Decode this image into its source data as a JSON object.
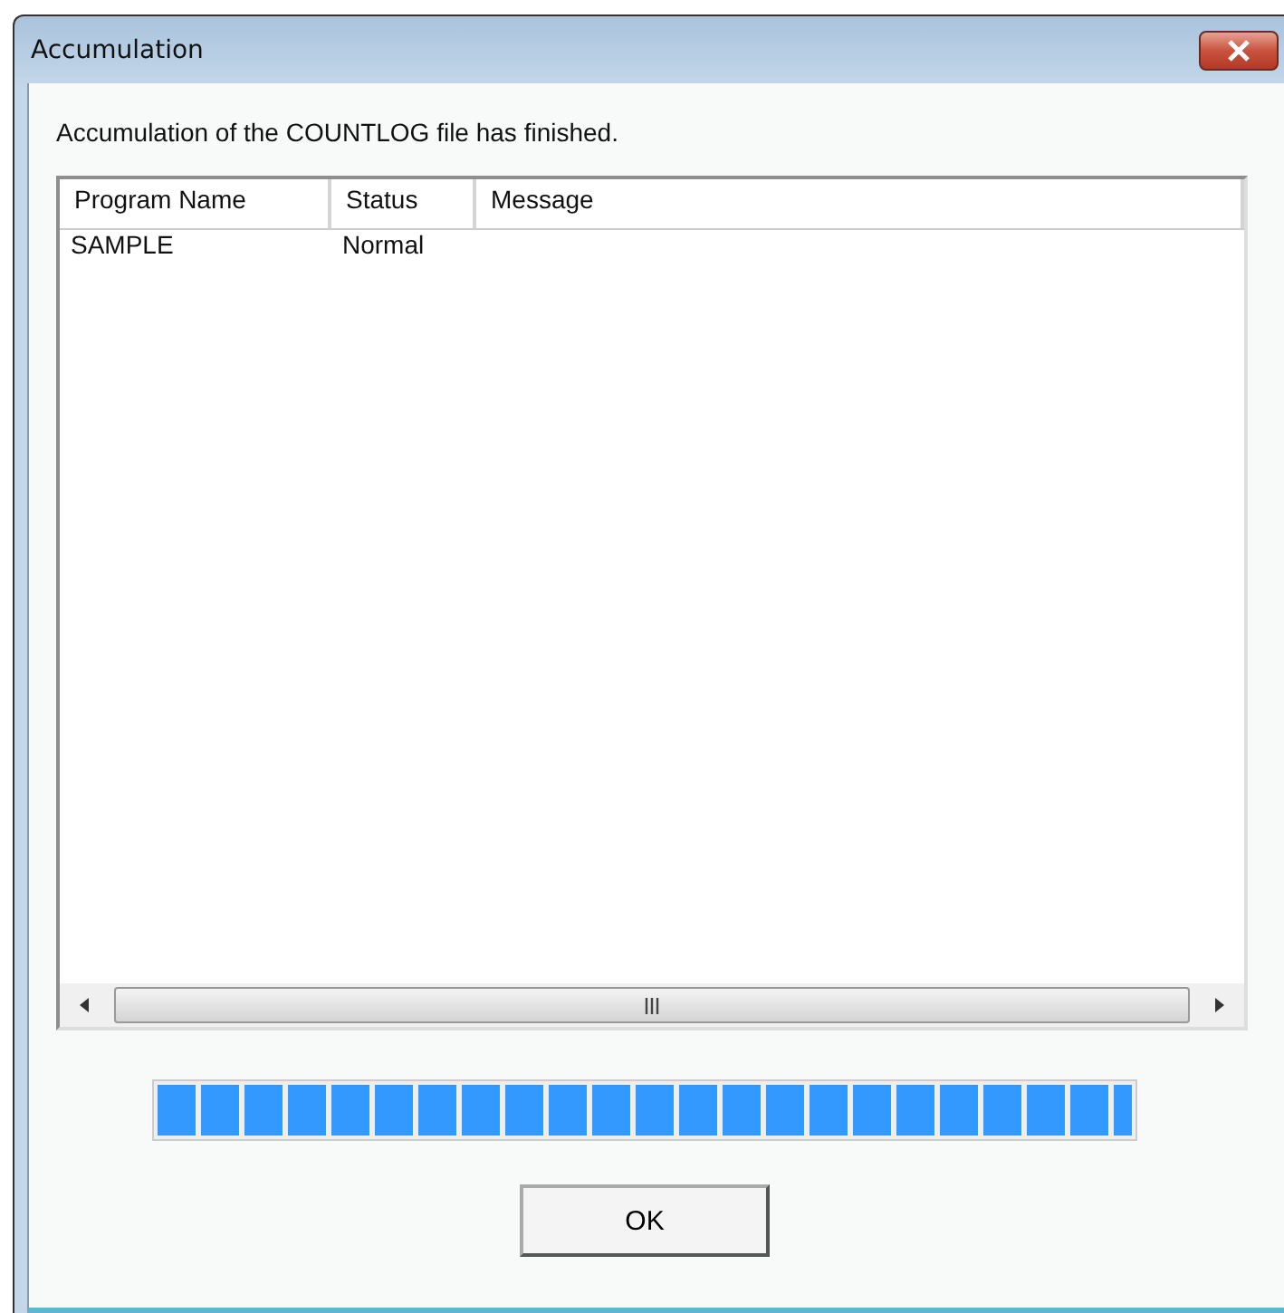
{
  "window": {
    "title": "Accumulation"
  },
  "message": "Accumulation of the COUNTLOG file has finished.",
  "table": {
    "columns": [
      "Program Name",
      "Status",
      "Message"
    ],
    "rows": [
      [
        "SAMPLE",
        "Normal",
        ""
      ]
    ]
  },
  "progress": {
    "level": 1
  },
  "buttons": [
    "OK"
  ]
}
